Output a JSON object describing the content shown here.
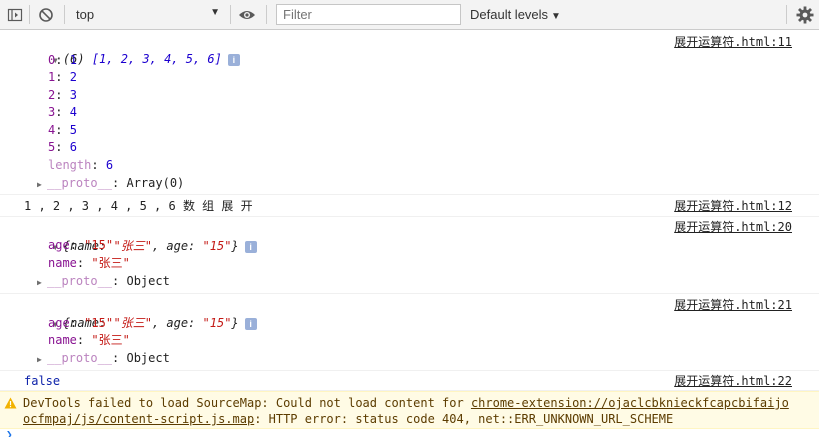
{
  "toolbar": {
    "context_value": "top",
    "filter_placeholder": "Filter",
    "levels_label": "Default levels",
    "icons": [
      "sidebar-toggle-icon",
      "clear-console-icon",
      "eye-icon",
      "settings-gear-icon"
    ]
  },
  "messages": {
    "m1": {
      "source": "展开运算符.html:11",
      "summary_count": "(6)",
      "summary_array": "[1, 2, 3, 4, 5, 6]",
      "entries": [
        {
          "key": "0",
          "value": "1"
        },
        {
          "key": "1",
          "value": "2"
        },
        {
          "key": "2",
          "value": "3"
        },
        {
          "key": "3",
          "value": "4"
        },
        {
          "key": "4",
          "value": "5"
        },
        {
          "key": "5",
          "value": "6"
        }
      ],
      "length_key": "length",
      "length_value": "6",
      "proto_key": "__proto__",
      "proto_value": "Array(0)"
    },
    "m2": {
      "source": "展开运算符.html:12",
      "text": "1 , 2 , 3 , 4 , 5 , 6 数 组 展 开"
    },
    "m3": {
      "source": "展开运算符.html:20",
      "summary_open": "{name: ",
      "summary_name": "\"张三\"",
      "summary_mid": ", age: ",
      "summary_age": "\"15\"",
      "summary_close": "}",
      "age_key": "age",
      "age_value": "\"15\"",
      "name_key": "name",
      "name_value": "\"张三\"",
      "proto_key": "__proto__",
      "proto_value": "Object"
    },
    "m4": {
      "source": "展开运算符.html:21",
      "summary_open": "{name: ",
      "summary_name": "\"张三\"",
      "summary_mid": ", age: ",
      "summary_age": "\"15\"",
      "summary_close": "}",
      "age_key": "age",
      "age_value": "\"15\"",
      "name_key": "name",
      "name_value": "\"张三\"",
      "proto_key": "__proto__",
      "proto_value": "Object"
    },
    "m5": {
      "source": "展开运算符.html:22",
      "text": "false"
    }
  },
  "warning": {
    "line1_prefix": "DevTools failed to load SourceMap: Could not load content for ",
    "line1_link": "chrome-extension://ojaclcbknieckfcapcbifaijo",
    "line2_link": "ocfmpaj/js/content-script.js.map",
    "line2_suffix": ": HTTP error: status code 404, net::ERR_UNKNOWN_URL_SCHEME"
  },
  "colors": {
    "key": "#881391",
    "number": "#1c00cf",
    "string": "#c41a16",
    "warning_bg": "#fffbe5",
    "warning_text": "#5c3c00"
  }
}
